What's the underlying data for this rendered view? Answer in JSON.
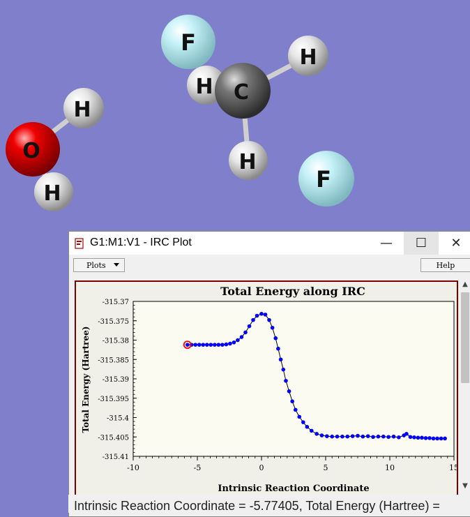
{
  "molecule": {
    "atoms": [
      {
        "element": "F",
        "color": "#a9e3ea",
        "label": "F"
      },
      {
        "element": "H",
        "color": "#d9d9d9",
        "label": "H"
      },
      {
        "element": "C",
        "color": "#6b6b6b",
        "label": "C"
      },
      {
        "element": "H",
        "color": "#d9d9d9",
        "label": "H"
      },
      {
        "element": "H",
        "color": "#d9d9d9",
        "label": "H"
      },
      {
        "element": "F",
        "color": "#a9e3ea",
        "label": "F"
      },
      {
        "element": "H",
        "color": "#d9d9d9",
        "label": "H"
      },
      {
        "element": "O",
        "color": "#e30000",
        "label": "O"
      },
      {
        "element": "H",
        "color": "#d9d9d9",
        "label": "H"
      }
    ],
    "background": "#7f7fcb"
  },
  "window": {
    "title": "G1:M1:V1 - IRC Plot",
    "minimize_symbol": "—",
    "maximize_symbol": "☐",
    "close_symbol": "✕"
  },
  "toolbar": {
    "plots_label": "Plots",
    "help_label": "Help"
  },
  "status_bar": {
    "text": "Intrinsic Reaction Coordinate = -5.77405, Total Energy (Hartree) ="
  },
  "chart_data": {
    "type": "line",
    "title": "Total Energy along IRC",
    "xlabel": "Intrinsic Reaction Coordinate",
    "ylabel": "Total Energy (Hartree)",
    "xlim": [
      -10,
      15
    ],
    "ylim": [
      -315.41,
      -315.37
    ],
    "x_ticks": [
      "-10",
      "-5",
      "0",
      "5",
      "10",
      "15"
    ],
    "y_ticks": [
      "-315.37",
      "-315.375",
      "-315.38",
      "-315.385",
      "-315.39",
      "-315.395",
      "-315.4",
      "-315.405",
      "-315.41"
    ],
    "series": [
      {
        "color": "#0000ff",
        "points": [
          [
            -5.77,
            -315.3812
          ],
          [
            -5.45,
            -315.3812
          ],
          [
            -5.15,
            -315.3812
          ],
          [
            -4.85,
            -315.3812
          ],
          [
            -4.55,
            -315.3812
          ],
          [
            -4.25,
            -315.3812
          ],
          [
            -3.95,
            -315.3812
          ],
          [
            -3.65,
            -315.3812
          ],
          [
            -3.35,
            -315.3812
          ],
          [
            -3.05,
            -315.3812
          ],
          [
            -2.75,
            -315.3811
          ],
          [
            -2.45,
            -315.3809
          ],
          [
            -2.15,
            -315.3806
          ],
          [
            -1.85,
            -315.38
          ],
          [
            -1.55,
            -315.3792
          ],
          [
            -1.25,
            -315.378
          ],
          [
            -0.95,
            -315.3764
          ],
          [
            -0.65,
            -315.3748
          ],
          [
            -0.35,
            -315.3737
          ],
          [
            0.0,
            -315.3732
          ],
          [
            0.3,
            -315.3734
          ],
          [
            0.6,
            -315.3748
          ],
          [
            0.85,
            -315.3768
          ],
          [
            1.1,
            -315.3795
          ],
          [
            1.3,
            -315.3822
          ],
          [
            1.5,
            -315.385
          ],
          [
            1.7,
            -315.3876
          ],
          [
            1.9,
            -315.3905
          ],
          [
            2.15,
            -315.3932
          ],
          [
            2.4,
            -315.3958
          ],
          [
            2.65,
            -315.398
          ],
          [
            2.95,
            -315.3998
          ],
          [
            3.25,
            -315.4012
          ],
          [
            3.55,
            -315.4024
          ],
          [
            3.9,
            -315.4034
          ],
          [
            4.3,
            -315.4042
          ],
          [
            4.7,
            -315.4046
          ],
          [
            5.1,
            -315.4048
          ],
          [
            5.5,
            -315.4049
          ],
          [
            5.9,
            -315.4049
          ],
          [
            6.3,
            -315.4049
          ],
          [
            6.7,
            -315.4049
          ],
          [
            7.1,
            -315.4048
          ],
          [
            7.5,
            -315.4047
          ],
          [
            7.9,
            -315.4049
          ],
          [
            8.3,
            -315.4048
          ],
          [
            8.7,
            -315.405
          ],
          [
            9.1,
            -315.4049
          ],
          [
            9.5,
            -315.4049
          ],
          [
            9.9,
            -315.405
          ],
          [
            10.3,
            -315.4049
          ],
          [
            10.7,
            -315.4051
          ],
          [
            11.1,
            -315.4046
          ],
          [
            11.3,
            -315.4042
          ],
          [
            11.6,
            -315.405
          ],
          [
            11.9,
            -315.4051
          ],
          [
            12.2,
            -315.4052
          ],
          [
            12.5,
            -315.4052
          ],
          [
            12.8,
            -315.4053
          ],
          [
            13.1,
            -315.4053
          ],
          [
            13.4,
            -315.4054
          ],
          [
            13.7,
            -315.4054
          ],
          [
            14.0,
            -315.4054
          ],
          [
            14.3,
            -315.4054
          ]
        ]
      }
    ],
    "current_point": [
      -5.77405,
      -315.3812
    ],
    "current_point_color": "#ff0000",
    "line_color": "#000000"
  }
}
